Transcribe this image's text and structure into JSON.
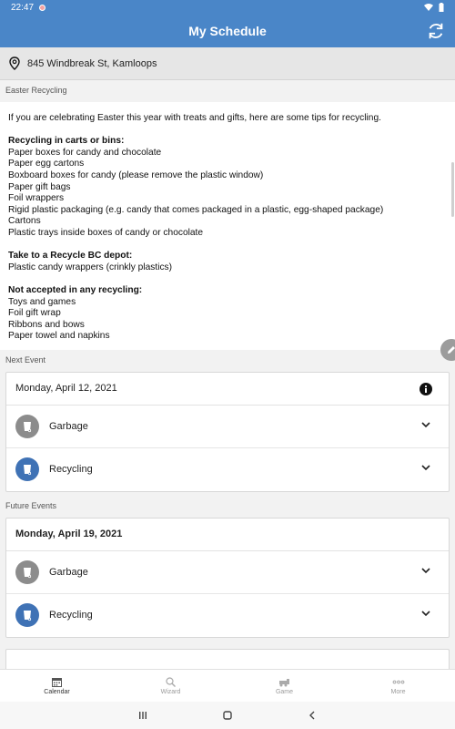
{
  "status_bar": {
    "time": "22:47"
  },
  "app_bar": {
    "title": "My Schedule"
  },
  "address": {
    "text": "845 Windbreak St, Kamloops"
  },
  "notice": {
    "label": "Easter Recycling",
    "intro": "If you are celebrating Easter this year with treats and gifts, here are some tips for recycling.",
    "groups": [
      {
        "heading": "Recycling in carts or bins:",
        "items": [
          "Paper boxes for candy and chocolate",
          "Paper egg cartons",
          "Boxboard boxes for candy (please remove the plastic window)",
          "Paper gift bags",
          "Foil wrappers",
          "Rigid plastic packaging (e.g. candy that comes packaged in a plastic, egg-shaped package)",
          "Cartons",
          "Plastic trays inside boxes of candy or chocolate"
        ]
      },
      {
        "heading": "Take to a Recycle BC depot:",
        "items": [
          "Plastic candy wrappers (crinkly plastics)"
        ]
      },
      {
        "heading": "Not accepted in any recycling:",
        "items": [
          "Toys and games",
          "Foil gift wrap",
          "Ribbons and bows",
          "Paper towel and napkins"
        ]
      }
    ]
  },
  "next_event": {
    "label": "Next Event",
    "date": "Monday, April 12, 2021",
    "items": [
      {
        "name": "Garbage",
        "color": "#8c8c8c"
      },
      {
        "name": "Recycling",
        "color": "#3f72b5"
      }
    ]
  },
  "future_events": {
    "label": "Future Events",
    "date": "Monday, April 19, 2021",
    "items": [
      {
        "name": "Garbage",
        "color": "#8c8c8c"
      },
      {
        "name": "Recycling",
        "color": "#3f72b5"
      }
    ]
  },
  "bottom_nav": {
    "items": [
      {
        "label": "Calendar",
        "icon": "calendar-icon",
        "active": true
      },
      {
        "label": "Wizard",
        "icon": "search-icon",
        "active": false
      },
      {
        "label": "Game",
        "icon": "game-icon",
        "active": false
      },
      {
        "label": "More",
        "icon": "more-icon",
        "active": false
      }
    ]
  },
  "colors": {
    "primary": "#4a86c8",
    "garbage": "#8c8c8c",
    "recycling": "#3f72b5"
  }
}
